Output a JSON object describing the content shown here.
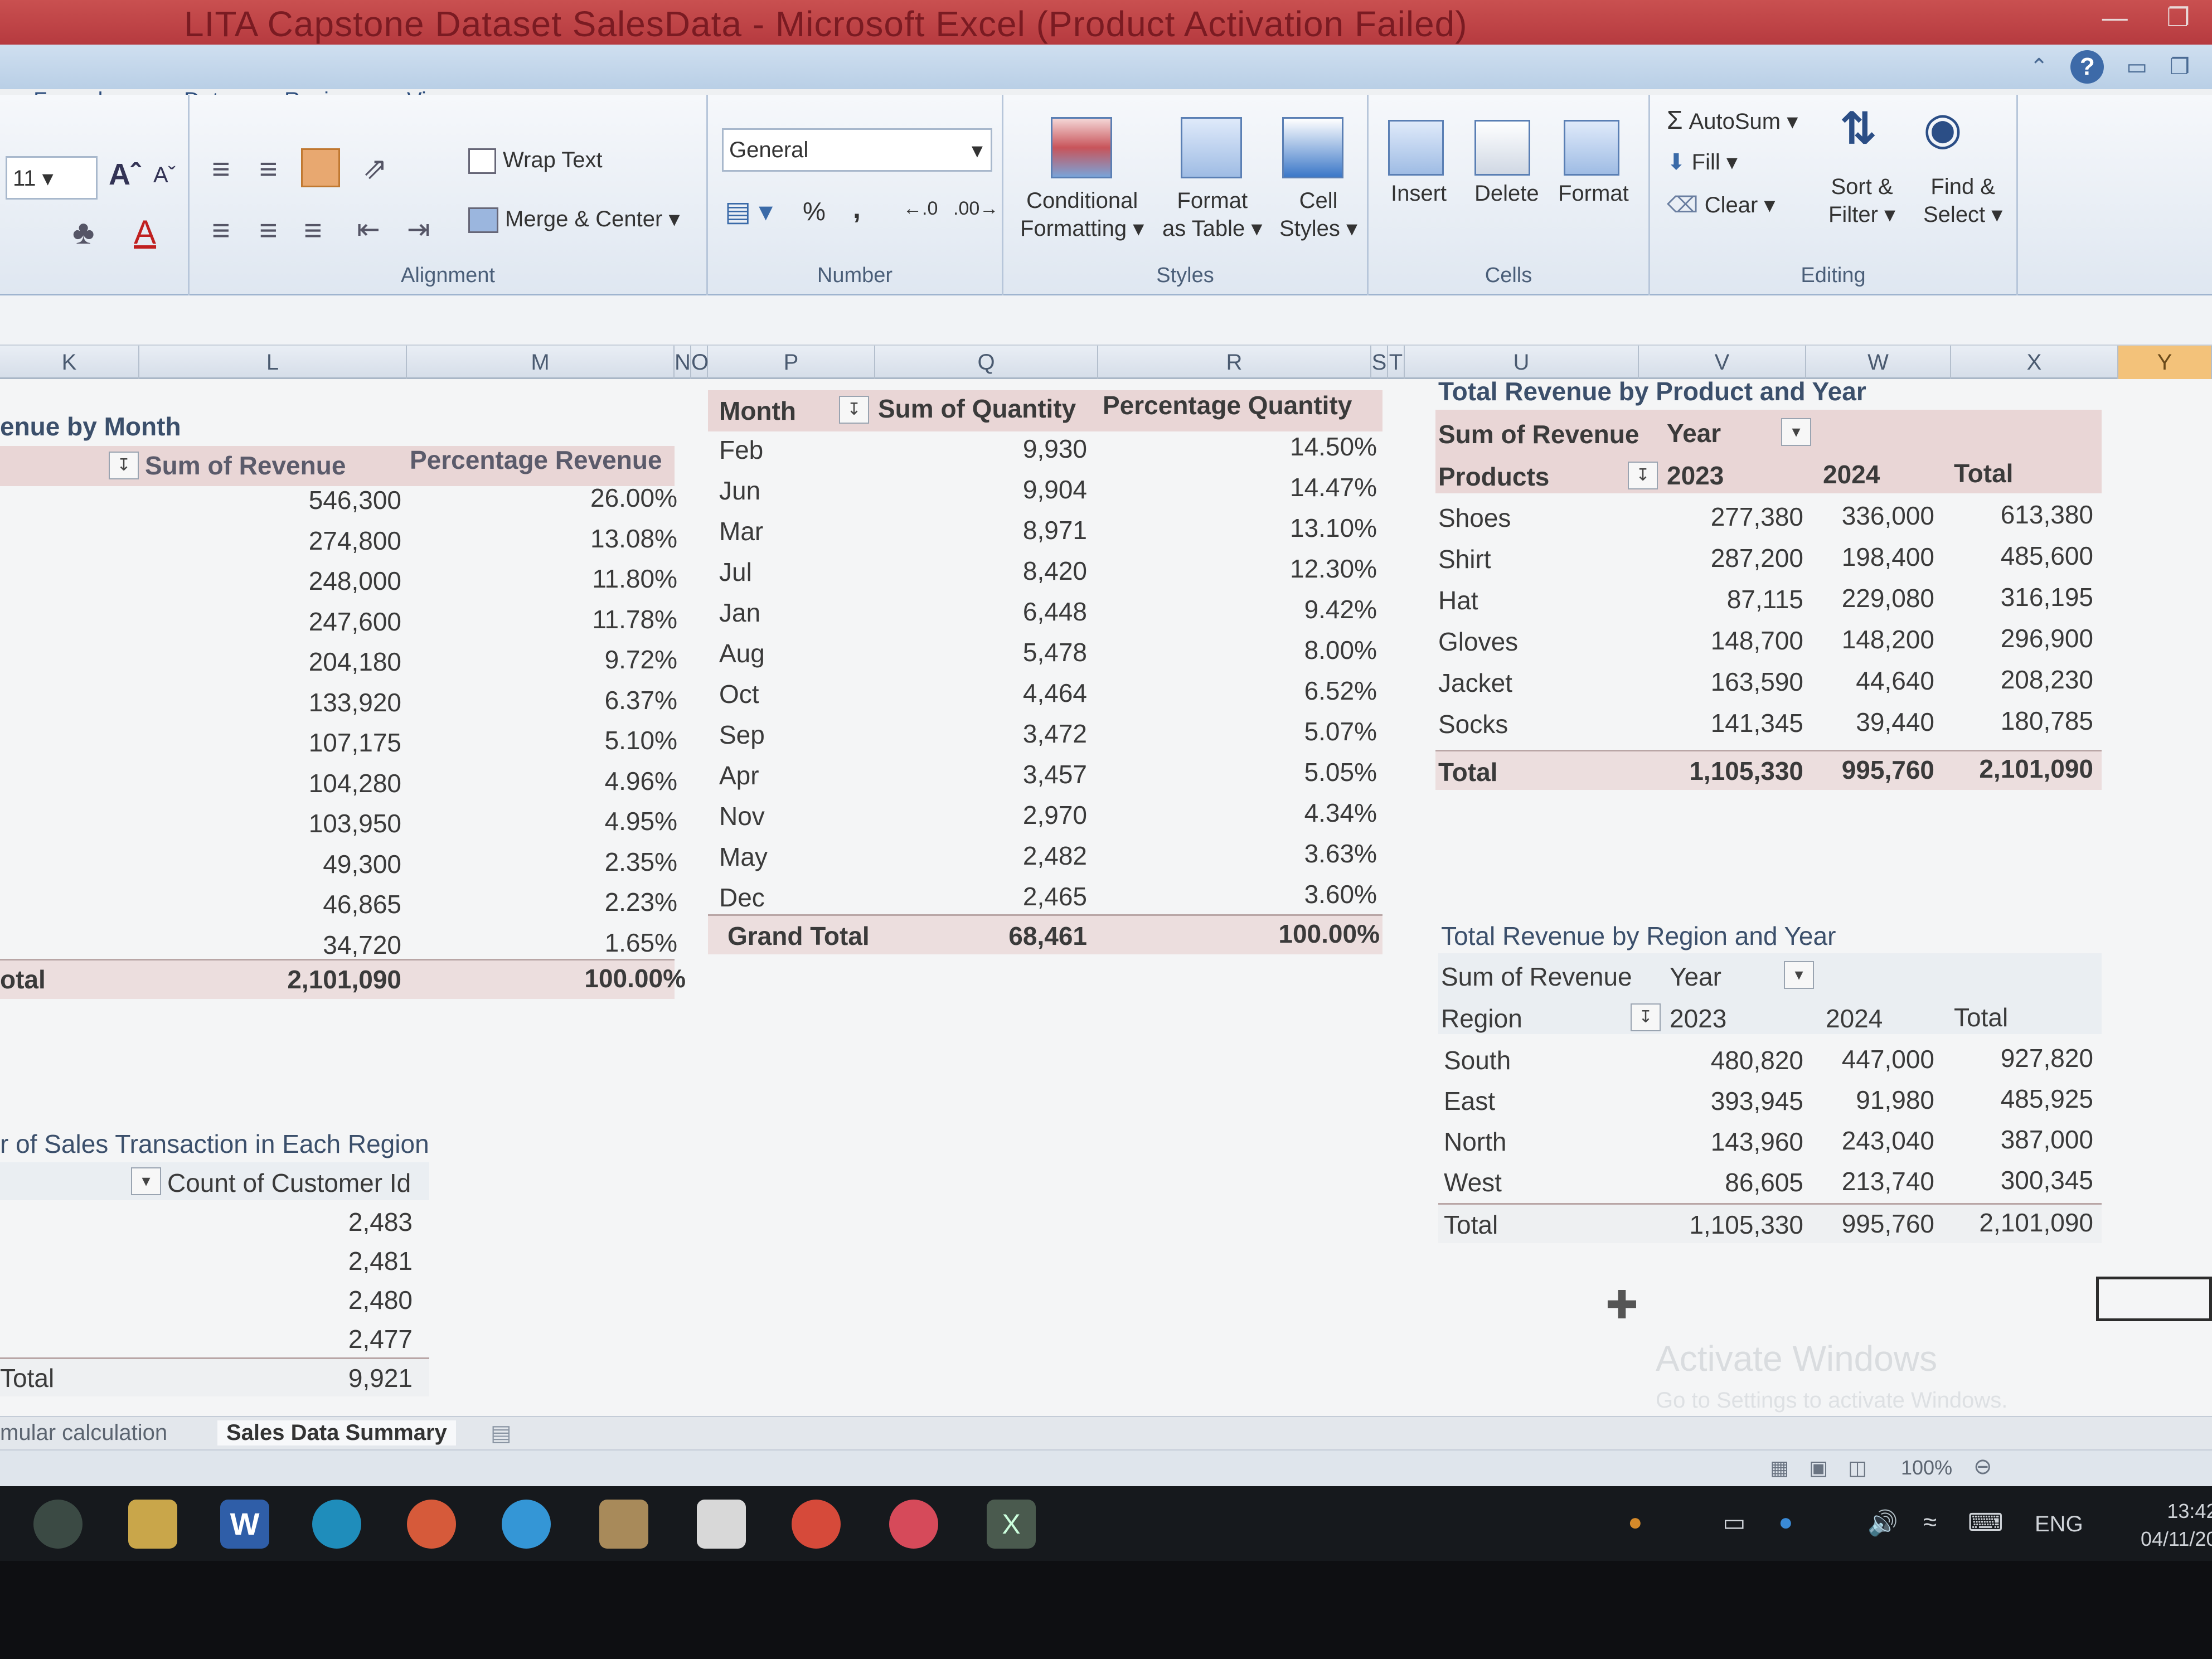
{
  "window": {
    "title": "LITA Capstone Dataset SalesData - Microsoft Excel (Product Activation Failed)"
  },
  "tabs": [
    "Formulas",
    "Data",
    "Review",
    "View"
  ],
  "ribbon": {
    "font_size": "11",
    "wrap_text": "Wrap Text",
    "merge_center": "Merge & Center",
    "alignment_label": "Alignment",
    "number_format": "General",
    "number_label": "Number",
    "percent_symbol": "%",
    "comma_symbol": ",",
    "conditional_formatting": [
      "Conditional",
      "Formatting"
    ],
    "format_as_table": [
      "Format",
      "as Table"
    ],
    "cell_styles": [
      "Cell",
      "Styles"
    ],
    "styles_label": "Styles",
    "insert": "Insert",
    "delete": "Delete",
    "format": "Format",
    "cells_label": "Cells",
    "autosum": "AutoSum",
    "fill": "Fill",
    "clear": "Clear",
    "sort_filter": [
      "Sort &",
      "Filter"
    ],
    "find_select": [
      "Find &",
      "Select"
    ],
    "editing_label": "Editing"
  },
  "columns": [
    "K",
    "L",
    "M",
    "N",
    "O",
    "P",
    "Q",
    "R",
    "S",
    "T",
    "U",
    "V",
    "W",
    "X",
    "Y"
  ],
  "revenue_by_month": {
    "title": "enue by Month",
    "col_revenue": "Sum of Revenue",
    "col_pct": "Percentage Revenue",
    "rows": [
      {
        "revenue": "546,300",
        "pct": "26.00%"
      },
      {
        "revenue": "274,800",
        "pct": "13.08%"
      },
      {
        "revenue": "248,000",
        "pct": "11.80%"
      },
      {
        "revenue": "247,600",
        "pct": "11.78%"
      },
      {
        "revenue": "204,180",
        "pct": "9.72%"
      },
      {
        "revenue": "133,920",
        "pct": "6.37%"
      },
      {
        "revenue": "107,175",
        "pct": "5.10%"
      },
      {
        "revenue": "104,280",
        "pct": "4.96%"
      },
      {
        "revenue": "103,950",
        "pct": "4.95%"
      },
      {
        "revenue": "49,300",
        "pct": "2.35%"
      },
      {
        "revenue": "46,865",
        "pct": "2.23%"
      },
      {
        "revenue": "34,720",
        "pct": "1.65%"
      }
    ],
    "total_label": "otal",
    "total_revenue": "2,101,090",
    "total_pct": "100.00%"
  },
  "quantity_by_month": {
    "col_month": "Month",
    "col_qty": "Sum of Quantity",
    "col_pct": "Percentage Quantity",
    "rows": [
      {
        "month": "Feb",
        "qty": "9,930",
        "pct": "14.50%"
      },
      {
        "month": "Jun",
        "qty": "9,904",
        "pct": "14.47%"
      },
      {
        "month": "Mar",
        "qty": "8,971",
        "pct": "13.10%"
      },
      {
        "month": "Jul",
        "qty": "8,420",
        "pct": "12.30%"
      },
      {
        "month": "Jan",
        "qty": "6,448",
        "pct": "9.42%"
      },
      {
        "month": "Aug",
        "qty": "5,478",
        "pct": "8.00%"
      },
      {
        "month": "Oct",
        "qty": "4,464",
        "pct": "6.52%"
      },
      {
        "month": "Sep",
        "qty": "3,472",
        "pct": "5.07%"
      },
      {
        "month": "Apr",
        "qty": "3,457",
        "pct": "5.05%"
      },
      {
        "month": "Nov",
        "qty": "2,970",
        "pct": "4.34%"
      },
      {
        "month": "May",
        "qty": "2,482",
        "pct": "3.63%"
      },
      {
        "month": "Dec",
        "qty": "2,465",
        "pct": "3.60%"
      }
    ],
    "total_label": "Grand Total",
    "total_qty": "68,461",
    "total_pct": "100.00%"
  },
  "product_year": {
    "title": "Total Revenue by Product and Year",
    "value_label": "Sum of Revenue",
    "year_label": "Year",
    "row_label": "Products",
    "col_2023": "2023",
    "col_2024": "2024",
    "col_total": "Total",
    "rows": [
      {
        "name": "Shoes",
        "y2023": "277,380",
        "y2024": "336,000",
        "total": "613,380"
      },
      {
        "name": "Shirt",
        "y2023": "287,200",
        "y2024": "198,400",
        "total": "485,600"
      },
      {
        "name": "Hat",
        "y2023": "87,115",
        "y2024": "229,080",
        "total": "316,195"
      },
      {
        "name": "Gloves",
        "y2023": "148,700",
        "y2024": "148,200",
        "total": "296,900"
      },
      {
        "name": "Jacket",
        "y2023": "163,590",
        "y2024": "44,640",
        "total": "208,230"
      },
      {
        "name": "Socks",
        "y2023": "141,345",
        "y2024": "39,440",
        "total": "180,785"
      }
    ],
    "total_label": "Total",
    "total_2023": "1,105,330",
    "total_2024": "995,760",
    "total_all": "2,101,090"
  },
  "region_year": {
    "title": "Total Revenue by Region and Year",
    "value_label": "Sum of Revenue",
    "year_label": "Year",
    "row_label": "Region",
    "col_2023": "2023",
    "col_2024": "2024",
    "col_total": "Total",
    "rows": [
      {
        "name": "South",
        "y2023": "480,820",
        "y2024": "447,000",
        "total": "927,820"
      },
      {
        "name": "East",
        "y2023": "393,945",
        "y2024": "91,980",
        "total": "485,925"
      },
      {
        "name": "North",
        "y2023": "143,960",
        "y2024": "243,040",
        "total": "387,000"
      },
      {
        "name": "West",
        "y2023": "86,605",
        "y2024": "213,740",
        "total": "300,345"
      }
    ],
    "total_label": "Total",
    "total_2023": "1,105,330",
    "total_2024": "995,760",
    "total_all": "2,101,090"
  },
  "transactions_by_region": {
    "title": "r of Sales Transaction in Each Region",
    "col_count": "Count of Customer Id",
    "values": [
      "2,483",
      "2,481",
      "2,480",
      "2,477"
    ],
    "total_label": "Total",
    "total": "9,921"
  },
  "sheet_tabs": [
    "mular calculation",
    "Sales Data Summary"
  ],
  "status": {
    "zoom": "100%"
  },
  "watermark": {
    "line1": "Activate Windows",
    "line2": "Go to Settings to activate Windows."
  },
  "taskbar": {
    "lang": "ENG",
    "time": "13:42",
    "date": "04/11/20"
  }
}
